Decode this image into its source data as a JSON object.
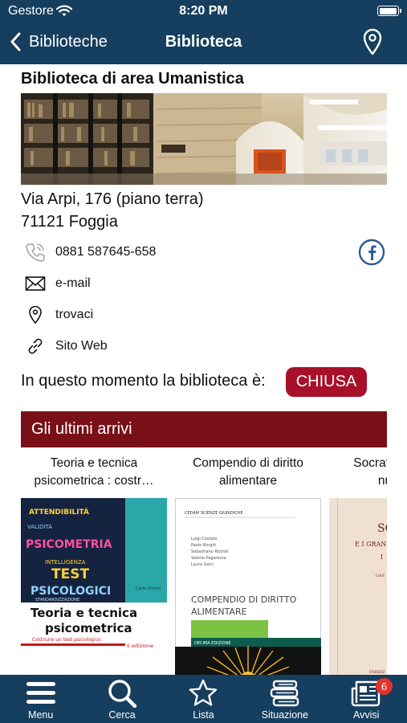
{
  "status_bar": {
    "carrier": "Gestore",
    "time": "8:20 PM",
    "battery_level": 1.0
  },
  "nav": {
    "back_label": "Biblioteche",
    "title": "Biblioteca"
  },
  "library": {
    "name": "Biblioteca di area Umanistica",
    "address_line1": "Via Arpi, 176 (piano terra)",
    "address_line2": "71121 Foggia",
    "phone": "0881 587645-658",
    "email_label": "e-mail",
    "map_label": "trovaci",
    "web_label": "Sito Web",
    "open_status_text": "In questo momento la biblioteca è:",
    "open_status_value": "CHIUSA"
  },
  "arrivals": {
    "heading": "Gli ultimi arrivi",
    "books": [
      {
        "title": "Teoria e tecnica psicometrica : costr…",
        "cover": {
          "words": [
            "PSICOMETRIA",
            "TEST",
            "PSICOLOGICI",
            "INTELLIGENZA",
            "VALIDITÀ",
            "ATTENDIBILITÀ",
            "STANDARDIZZAZIONE"
          ],
          "publisher": "Carlo Chiorri",
          "big_title": "Teoria e tecnica psicometrica",
          "subtitle": "Costruire un test psicologico",
          "edition": "II edizione"
        }
      },
      {
        "title": "Compendio di diritto alimentare",
        "cover": {
          "series": "CEDAM SCIENZE GIURIDICHE",
          "authors": [
            "Luigi Costato",
            "Paolo Borghi",
            "Sebastiano Rizzioli",
            "Valeria Paganizza",
            "Laura Salvi"
          ],
          "big_title": "COMPENDIO DI DIRITTO ALIMENTARE",
          "edition": "DECIMA EDIZIONE"
        }
      },
      {
        "title": "Socrate e i grandi nuotatori",
        "cover": {
          "top": "SO",
          "line2": "E I GRAN",
          "line3": "I",
          "author_mark": "GAS",
          "publisher_mark": "FARRIZ"
        }
      }
    ]
  },
  "tabs": [
    {
      "label": "Menu",
      "icon": "menu-icon"
    },
    {
      "label": "Cerca",
      "icon": "search-icon"
    },
    {
      "label": "Lista",
      "icon": "star-icon"
    },
    {
      "label": "Situazione",
      "icon": "books-stack-icon"
    },
    {
      "label": "Avvisi",
      "icon": "newspaper-icon",
      "badge": "6"
    }
  ],
  "colors": {
    "brand": "#163e5e",
    "closed_badge": "#a8102a",
    "section_header": "#7a1017",
    "icon_blue": "#2d5b96"
  }
}
